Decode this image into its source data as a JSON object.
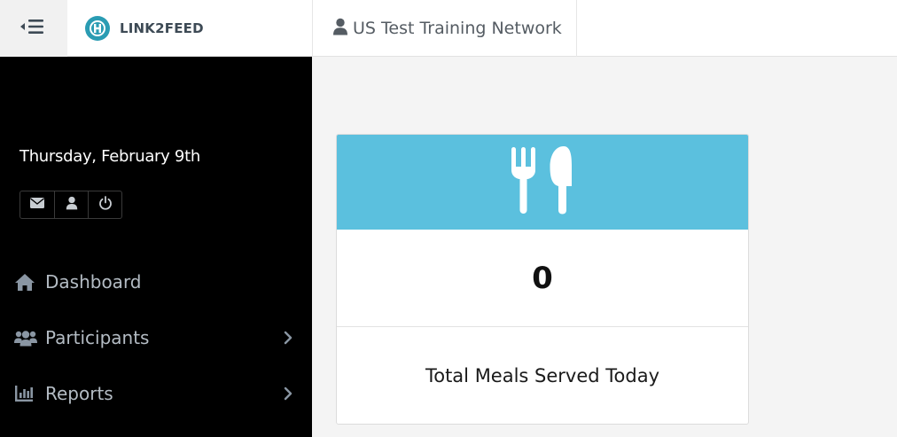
{
  "header": {
    "toggle_icon": "sidebar-toggle-icon",
    "brand": {
      "name": "LINK2FEED",
      "logo_icon": "link2feed-logo-icon",
      "logo_color": "#2a9cb3"
    },
    "network": {
      "label": "US Test Training Network",
      "icon": "user-icon"
    }
  },
  "sidebar": {
    "background": "#000000",
    "date": "Thursday, February 9th",
    "quick_actions": [
      {
        "icon": "envelope-icon"
      },
      {
        "icon": "user-icon"
      },
      {
        "icon": "power-icon"
      }
    ],
    "nav": [
      {
        "label": "Dashboard",
        "icon": "home-icon",
        "has_submenu": false
      },
      {
        "label": "Participants",
        "icon": "users-icon",
        "has_submenu": true
      },
      {
        "label": "Reports",
        "icon": "bar-chart-icon",
        "has_submenu": true
      }
    ]
  },
  "main": {
    "stat_card": {
      "header_color": "#5bc0de",
      "icon": "utensils-icon",
      "value": "0",
      "caption": "Total Meals Served Today"
    }
  }
}
